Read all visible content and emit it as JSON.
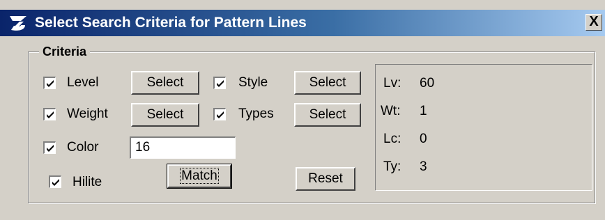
{
  "window": {
    "title": "Select Search Criteria for Pattern Lines",
    "close_label": "X",
    "icon": "microstation-logo-icon"
  },
  "criteria": {
    "group_label": "Criteria",
    "level": {
      "label": "Level",
      "checked": true,
      "button": "Select"
    },
    "style": {
      "label": "Style",
      "checked": true,
      "button": "Select"
    },
    "weight": {
      "label": "Weight",
      "checked": true,
      "button": "Select"
    },
    "types": {
      "label": "Types",
      "checked": true,
      "button": "Select"
    },
    "color": {
      "label": "Color",
      "checked": true,
      "value": "16"
    },
    "hilite": {
      "label": "Hilite",
      "checked": true
    },
    "match_button": "Match",
    "reset_button": "Reset"
  },
  "info": [
    {
      "key": "Lv:",
      "value": "60"
    },
    {
      "key": "Wt:",
      "value": "1"
    },
    {
      "key": "Lc:",
      "value": "0"
    },
    {
      "key": "Ty:",
      "value": "3"
    }
  ]
}
